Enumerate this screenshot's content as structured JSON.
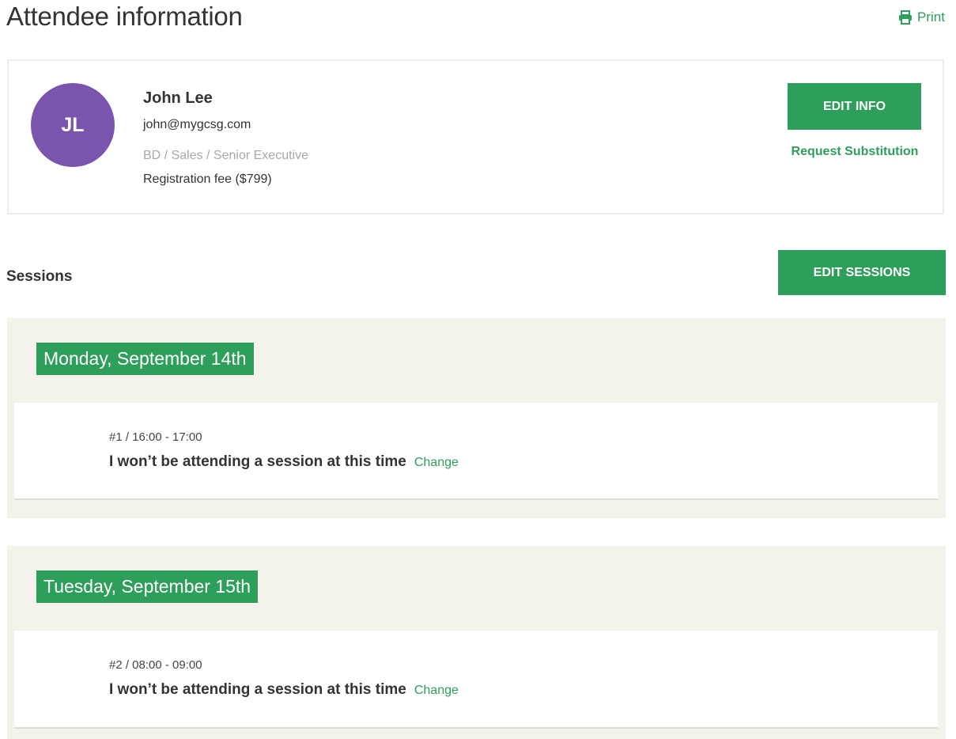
{
  "header": {
    "title": "Attendee information",
    "print_label": "Print",
    "print_icon": "printer-icon"
  },
  "attendee": {
    "initials": "JL",
    "avatar_color": "#7b55ad",
    "name": "John Lee",
    "email": "john@mygcsg.com",
    "role": "BD / Sales / Senior Executive",
    "fee": "Registration fee ($799)",
    "edit_info_label": "EDIT INFO",
    "request_substitution_label": "Request Substitution"
  },
  "sessions": {
    "title": "Sessions",
    "edit_sessions_label": "EDIT SESSIONS",
    "days": [
      {
        "date": "Monday, September 14th",
        "session_meta": "#1 / 16:00 - 17:00",
        "status": "I won’t be attending a session at this time",
        "change_label": "Change"
      },
      {
        "date": "Tuesday, September 15th",
        "session_meta": "#2 / 08:00 - 09:00",
        "status": "I won’t be attending a session at this time",
        "change_label": "Change"
      }
    ]
  },
  "colors": {
    "accent_green": "#2e9e5b",
    "day_background": "#f3f3ec",
    "muted_text": "#a8a8a8"
  }
}
